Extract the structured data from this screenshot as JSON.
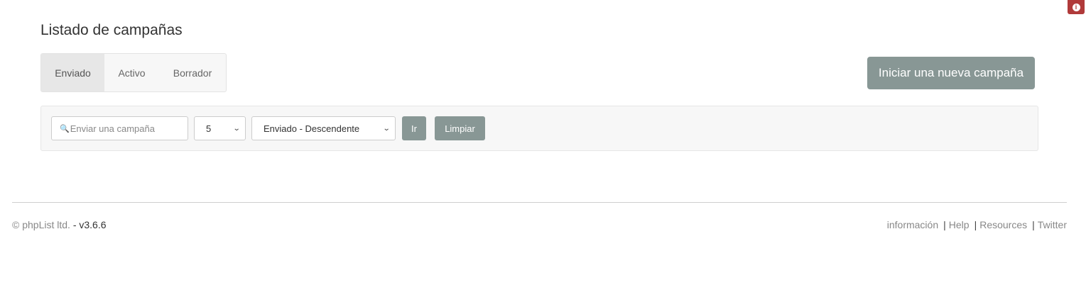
{
  "info_badge": {
    "icon": "info-icon",
    "color": "#b03a3a"
  },
  "page": {
    "title": "Listado de campañas"
  },
  "tabs": [
    {
      "label": "Enviado",
      "active": true
    },
    {
      "label": "Activo",
      "active": false
    },
    {
      "label": "Borrador",
      "active": false
    }
  ],
  "new_campaign_button": {
    "label": "Iniciar una nueva campaña",
    "color": "#889795"
  },
  "filters": {
    "search": {
      "icon": "search-icon",
      "placeholder": "Enviar una campaña",
      "value": ""
    },
    "count_select": {
      "value": "5"
    },
    "order_select": {
      "value": "Enviado - Descendente"
    },
    "go_button": {
      "label": "Ir"
    },
    "clear_button": {
      "label": "Limpiar"
    }
  },
  "footer": {
    "copyright": "© phpList ltd.",
    "version": "- v3.6.6",
    "links": [
      "información",
      "Help",
      "Resources",
      "Twitter"
    ],
    "separator": "|"
  }
}
